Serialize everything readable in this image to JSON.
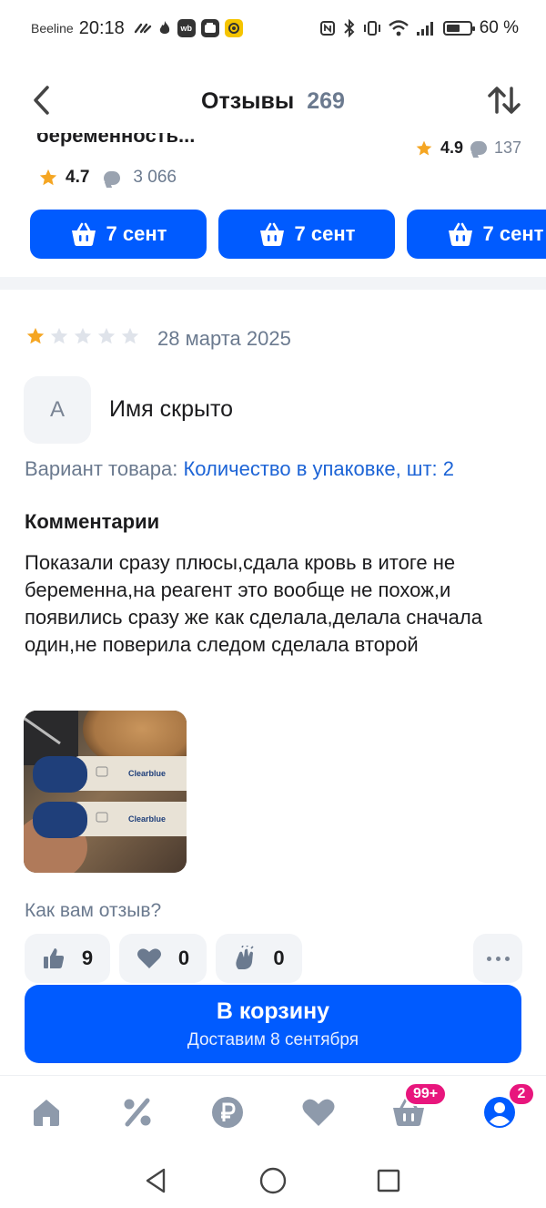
{
  "status_bar": {
    "carrier": "Beeline",
    "time": "20:18",
    "battery_text": "60 %",
    "battery_level": 0.6,
    "app_badges": [
      "wb"
    ],
    "icons": [
      "link-icon",
      "flame-icon",
      "wb-app-icon",
      "wallet-icon",
      "yellow-app-icon",
      "nfc-icon",
      "bluetooth-icon",
      "vibrate-icon",
      "wifi-icon",
      "signal-icon",
      "battery-icon"
    ]
  },
  "header": {
    "title": "Отзывы",
    "count": "269",
    "back_icon": "chevron-left-icon",
    "sort_icon": "sort-arrows-icon"
  },
  "carousel": {
    "cut_title": "беременность...",
    "cut_rating_value": "4.9",
    "cut_rating_count": "137",
    "rating_value": "4.7",
    "rating_count": "3 066",
    "cart_chips": [
      {
        "label": "7 сент"
      },
      {
        "label": "7 сент"
      },
      {
        "label": "7 сент"
      }
    ]
  },
  "review": {
    "rating": 1,
    "max_rating": 5,
    "date": "28 марта 2025",
    "avatar_letter": "А",
    "author": "Имя скрыто",
    "variant_label": "Вариант товара:",
    "variant_value": "Количество в упаковке, шт: 2",
    "comments_title": "Комментарии",
    "comment": "Показали сразу плюсы,сдала кровь в итоге не беременна,на реагент это вообще не похож,и появились сразу же как сделала,делала сначала один,не поверила следом сделала второй",
    "photo_text": [
      "Clearblue",
      "Clearblue"
    ]
  },
  "feedback": {
    "title": "Как вам отзыв?",
    "reactions": [
      {
        "icon": "thumbs-up-icon",
        "count": "9"
      },
      {
        "icon": "heart-icon",
        "count": "0"
      },
      {
        "icon": "clap-icon",
        "count": "0"
      }
    ],
    "more_icon": "more-dots-icon"
  },
  "add_to_cart": {
    "label": "В корзину",
    "delivery": "Доставим 8 сентября"
  },
  "bottom_nav": {
    "items": [
      {
        "icon": "home-icon"
      },
      {
        "icon": "percent-icon"
      },
      {
        "icon": "ruble-icon"
      },
      {
        "icon": "heart-icon"
      },
      {
        "icon": "cart-icon",
        "badge": "99+"
      },
      {
        "icon": "profile-icon",
        "badge": "2"
      }
    ]
  },
  "system_nav": {
    "icons": [
      "back-triangle-icon",
      "home-circle-icon",
      "recents-square-icon"
    ]
  },
  "colors": {
    "primary": "#005bff",
    "badge": "#e8167d",
    "star": "#f5a623",
    "link": "#1d64d6",
    "muted": "#6b7a8f"
  }
}
